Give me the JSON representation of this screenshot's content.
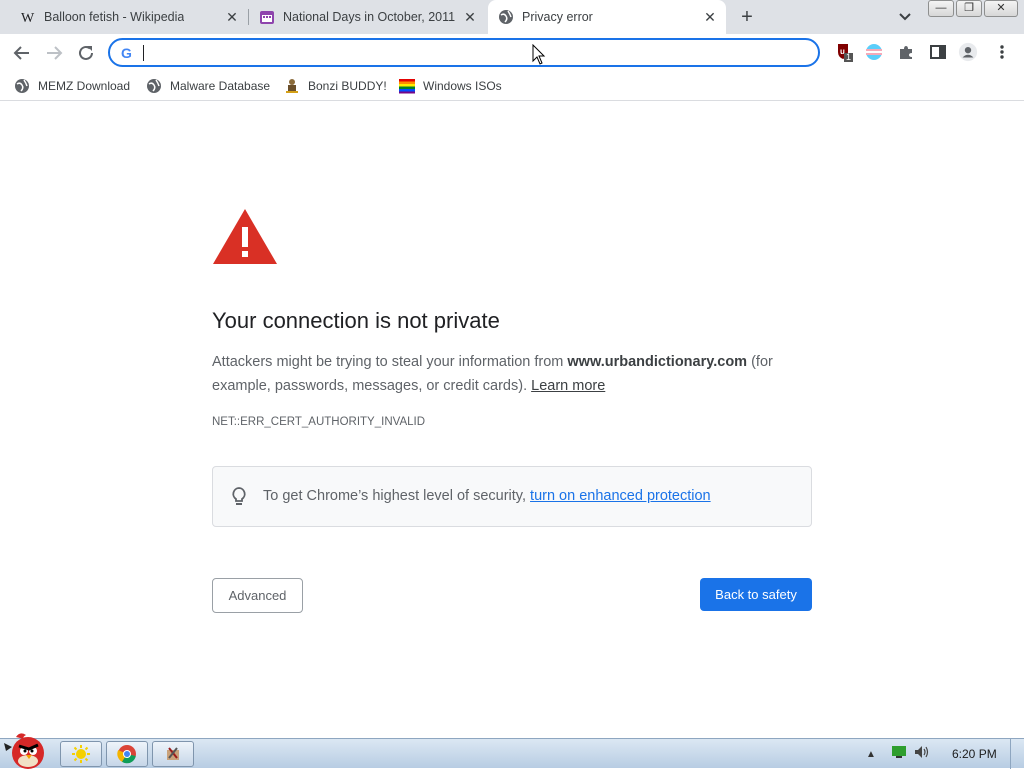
{
  "tabs": [
    {
      "title": "Balloon fetish - Wikipedia",
      "favicon": "wikipedia-icon",
      "active": false
    },
    {
      "title": "National Days in October, 2011 -",
      "favicon": "calendar-icon",
      "active": false
    },
    {
      "title": "Privacy error",
      "favicon": "globe-icon",
      "active": true
    }
  ],
  "toolbar": {
    "address_value": "",
    "extension_badge": "1"
  },
  "bookmarks": [
    {
      "label": "MEMZ Download",
      "icon": "globe-icon"
    },
    {
      "label": "Malware Database",
      "icon": "globe-icon"
    },
    {
      "label": "Bonzi BUDDY!",
      "icon": "bonzi-icon"
    },
    {
      "label": "Windows ISOs",
      "icon": "windows-flag-icon"
    }
  ],
  "error_page": {
    "heading": "Your connection is not private",
    "desc_prefix": "Attackers might be trying to steal your information from ",
    "domain": "www.urbandictionary.com",
    "desc_suffix": " (for example, passwords, messages, or credit cards). ",
    "learn_more": "Learn more",
    "error_code": "NET::ERR_CERT_AUTHORITY_INVALID",
    "enhanced_prefix": "To get Chrome’s highest level of security, ",
    "enhanced_link": "turn on enhanced protection",
    "advanced_label": "Advanced",
    "back_label": "Back to safety"
  },
  "colors": {
    "accent": "#1a73e8",
    "warning_red": "#d93025"
  },
  "taskbar": {
    "clock": "6:20 PM"
  }
}
